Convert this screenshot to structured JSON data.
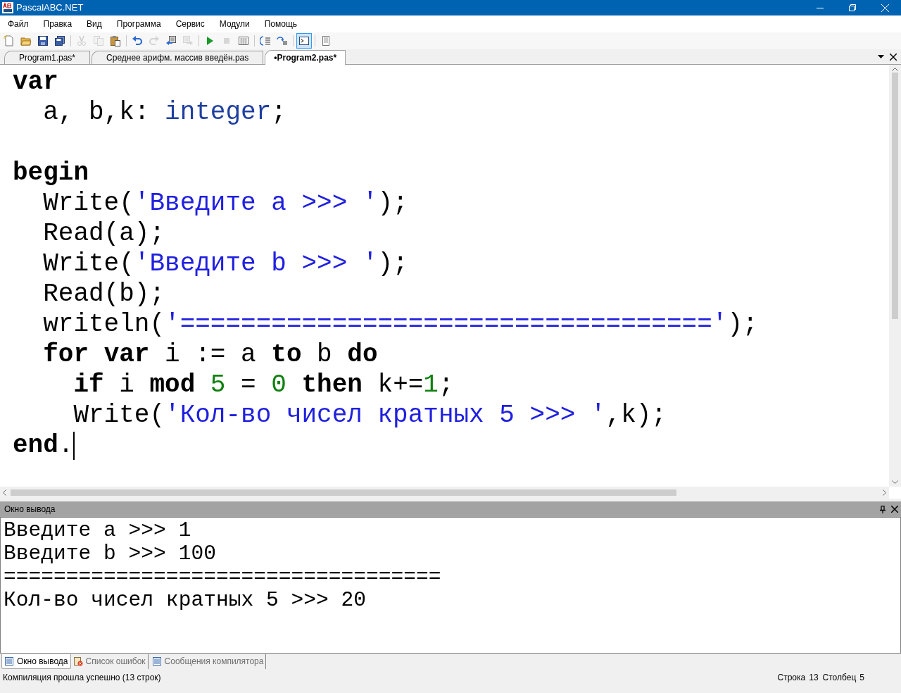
{
  "window": {
    "title": "PascalABC.NET"
  },
  "menu": [
    "Файл",
    "Правка",
    "Вид",
    "Программа",
    "Сервис",
    "Модули",
    "Помощь"
  ],
  "toolbar": [
    {
      "kind": "new",
      "disabled": false,
      "pressed": false
    },
    {
      "kind": "open",
      "disabled": false,
      "pressed": false
    },
    {
      "kind": "save",
      "disabled": false,
      "pressed": false
    },
    {
      "kind": "saveall",
      "disabled": false,
      "pressed": false
    },
    {
      "kind": "sep"
    },
    {
      "kind": "cut",
      "disabled": true,
      "pressed": false
    },
    {
      "kind": "copy",
      "disabled": true,
      "pressed": false
    },
    {
      "kind": "paste",
      "disabled": false,
      "pressed": false
    },
    {
      "kind": "sep"
    },
    {
      "kind": "undo",
      "disabled": false,
      "pressed": false
    },
    {
      "kind": "redo",
      "disabled": true,
      "pressed": false
    },
    {
      "kind": "back",
      "disabled": false,
      "pressed": false
    },
    {
      "kind": "forward",
      "disabled": true,
      "pressed": false
    },
    {
      "kind": "sep"
    },
    {
      "kind": "run",
      "disabled": false,
      "pressed": false
    },
    {
      "kind": "stop",
      "disabled": true,
      "pressed": false
    },
    {
      "kind": "grid",
      "disabled": false,
      "pressed": false
    },
    {
      "kind": "sep"
    },
    {
      "kind": "stepin",
      "disabled": false,
      "pressed": false
    },
    {
      "kind": "stepover",
      "disabled": false,
      "pressed": false
    },
    {
      "kind": "sep"
    },
    {
      "kind": "console",
      "disabled": false,
      "pressed": true
    },
    {
      "kind": "sep"
    },
    {
      "kind": "doc",
      "disabled": false,
      "pressed": false
    }
  ],
  "tabs": [
    {
      "label": "Program1.pas*",
      "selected": false
    },
    {
      "label": "Среднее арифм. массив введён.pas",
      "selected": false
    },
    {
      "label": "•Program2.pas*",
      "selected": true
    }
  ],
  "code": [
    {
      "kind": "line",
      "tokens": [
        {
          "kind": "kw",
          "text": "var"
        }
      ]
    },
    {
      "kind": "line",
      "tokens": [
        {
          "kind": "plain",
          "text": "  a, b,k: "
        },
        {
          "kind": "type",
          "text": "integer"
        },
        {
          "kind": "plain",
          "text": ";"
        }
      ]
    },
    {
      "kind": "blank"
    },
    {
      "kind": "line",
      "tokens": [
        {
          "kind": "kw",
          "text": "begin"
        }
      ]
    },
    {
      "kind": "line",
      "tokens": [
        {
          "kind": "plain",
          "text": "  Write("
        },
        {
          "kind": "str",
          "text": "'Введите a >>> '"
        },
        {
          "kind": "plain",
          "text": ");"
        }
      ]
    },
    {
      "kind": "line",
      "tokens": [
        {
          "kind": "plain",
          "text": "  Read(a);"
        }
      ]
    },
    {
      "kind": "line",
      "tokens": [
        {
          "kind": "plain",
          "text": "  Write("
        },
        {
          "kind": "str",
          "text": "'Введите b >>> '"
        },
        {
          "kind": "plain",
          "text": ");"
        }
      ]
    },
    {
      "kind": "line",
      "tokens": [
        {
          "kind": "plain",
          "text": "  Read(b);"
        }
      ]
    },
    {
      "kind": "line",
      "tokens": [
        {
          "kind": "plain",
          "text": "  writeln("
        },
        {
          "kind": "str",
          "text": "'==================================='"
        },
        {
          "kind": "plain",
          "text": ");"
        }
      ]
    },
    {
      "kind": "line",
      "tokens": [
        {
          "kind": "kw",
          "text": "  for"
        },
        {
          "kind": "kw",
          "text": " var"
        },
        {
          "kind": "plain",
          "text": " i := a "
        },
        {
          "kind": "kw",
          "text": "to"
        },
        {
          "kind": "plain",
          "text": " b "
        },
        {
          "kind": "kw",
          "text": "do"
        }
      ]
    },
    {
      "kind": "line",
      "tokens": [
        {
          "kind": "kw",
          "text": "    if"
        },
        {
          "kind": "plain",
          "text": " i "
        },
        {
          "kind": "kw",
          "text": "mod "
        },
        {
          "kind": "num",
          "text": "5"
        },
        {
          "kind": "plain",
          "text": " = "
        },
        {
          "kind": "num",
          "text": "0"
        },
        {
          "kind": "kw",
          "text": " then"
        },
        {
          "kind": "plain",
          "text": " k+="
        },
        {
          "kind": "num",
          "text": "1"
        },
        {
          "kind": "plain",
          "text": ";"
        }
      ]
    },
    {
      "kind": "line",
      "tokens": [
        {
          "kind": "plain",
          "text": "    Write("
        },
        {
          "kind": "str",
          "text": "'Кол-во чисел кратных 5 >>> '"
        },
        {
          "kind": "plain",
          "text": ",k);"
        }
      ]
    },
    {
      "kind": "line",
      "caret": true,
      "tokens": [
        {
          "kind": "kw",
          "text": "end"
        },
        {
          "kind": "plain",
          "text": "."
        }
      ]
    }
  ],
  "output_panel": {
    "title": "Окно вывода",
    "lines": [
      "Введите a >>> 1",
      "Введите b >>> 100",
      "===================================",
      "Кол-во чисел кратных 5 >>> 20"
    ]
  },
  "bottom_tabs": [
    {
      "label": "Окно вывода",
      "kind": "output",
      "selected": true
    },
    {
      "label": "Список ошибок",
      "kind": "errors",
      "selected": false
    },
    {
      "label": "Сообщения компилятора",
      "kind": "messages",
      "selected": false
    }
  ],
  "status_bar": {
    "message": "Компиляция прошла успешно (13 строк)",
    "row_label": "Строка",
    "row": "13",
    "col_label": "Столбец",
    "col": "5"
  }
}
